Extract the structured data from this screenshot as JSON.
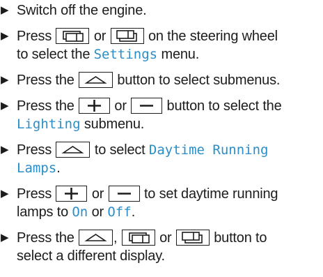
{
  "steps": [
    {
      "text": "Switch off the engine."
    },
    {
      "a": "Press",
      "b": "or",
      "c": "on the steering wheel",
      "d": "to select the",
      "e": "Settings",
      "f": "menu."
    },
    {
      "a": "Press the",
      "b": "button to select submenus."
    },
    {
      "a": "Press the",
      "b": "or",
      "c": "button to select the",
      "d": "Lighting",
      "e": "submenu."
    },
    {
      "a": "Press",
      "b": "to select",
      "c": "Daytime Running",
      "d": "Lamps",
      "e": "."
    },
    {
      "a": "Press",
      "b": "or",
      "c": "to set daytime running",
      "d": "lamps to",
      "e": "On",
      "f": "or",
      "g": "Off",
      "h": "."
    },
    {
      "a": "Press the",
      "b": ",",
      "c": "or",
      "d": "button to",
      "e": "select a different display."
    }
  ],
  "icons": {
    "bullet": "right-triangle-bullet",
    "display_back": "display-previous-key-icon",
    "display_forward": "display-next-key-icon",
    "ok": "up-arrow-key-icon",
    "plus": "plus-key-icon",
    "minus": "minus-key-icon"
  },
  "colors": {
    "text": "#1c1c1c",
    "highlight": "#2a8ec8"
  }
}
